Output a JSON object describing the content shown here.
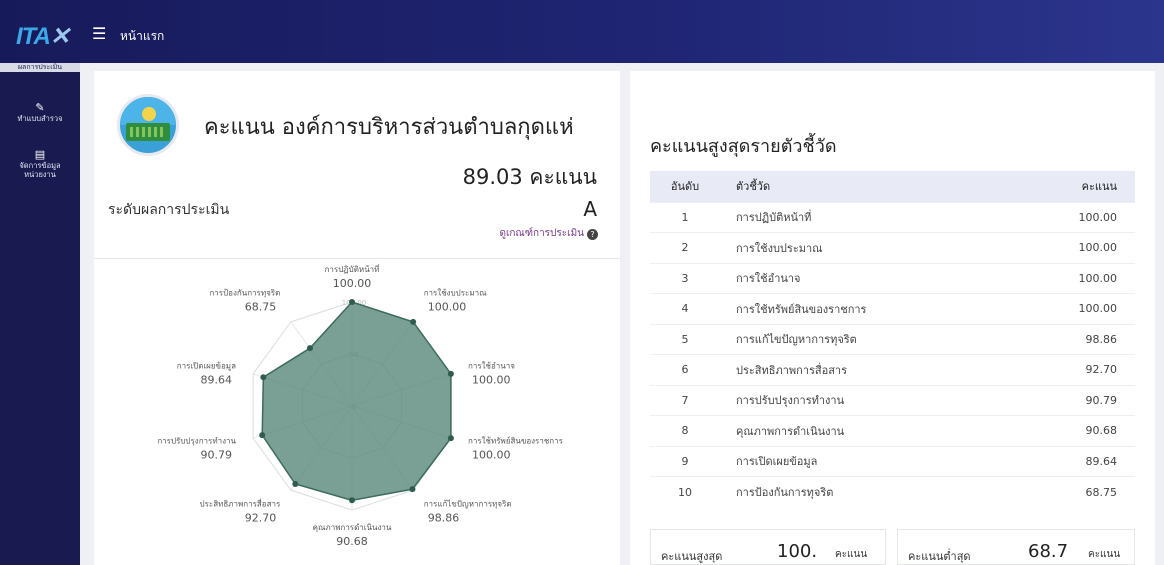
{
  "app": {
    "logo_text": "ITA",
    "logo_mark": "✕",
    "nav_home": "หน้าแรก"
  },
  "sidebar": {
    "cut_label": "ผลการประเมิน",
    "items": [
      {
        "icon": "edit-icon",
        "glyph": "✎",
        "label": "ทำแบบสำรวจ"
      },
      {
        "icon": "clipboard-icon",
        "glyph": "▤",
        "label_line1": "จัดการข้อมูล",
        "label_line2": "หน่วยงาน"
      }
    ]
  },
  "summary": {
    "org_title": "คะแนน องค์การบริหารส่วนตำบลกุดแห่",
    "total_score": "89.03 คะแนน",
    "level_label": "ระดับผลการประเมิน",
    "level_value": "A",
    "criteria_link": "ดูเกณฑ์การประเมิน"
  },
  "chart_data": {
    "type": "radar",
    "title": "",
    "rmax": 100,
    "ring_labels": [
      "0",
      "50",
      "100.00"
    ],
    "categories": [
      "การปฏิบัติหน้าที่",
      "การใช้งบประมาณ",
      "การใช้อำนาจ",
      "การใช้ทรัพย์สินของราชการ",
      "การแก้ไขปัญหาการทุจริต",
      "คุณภาพการดำเนินงาน",
      "ประสิทธิภาพการสื่อสาร",
      "การปรับปรุงการทำงาน",
      "การเปิดเผยข้อมูล",
      "การป้องกันการทุจริต"
    ],
    "values": [
      100.0,
      100.0,
      100.0,
      100.0,
      98.86,
      90.68,
      92.7,
      90.79,
      89.64,
      68.75
    ],
    "value_labels": [
      "100.00",
      "100.00",
      "100.00",
      "100.00",
      "98.86",
      "90.68",
      "92.70",
      "90.79",
      "89.64",
      "68.75"
    ],
    "fill_color": "#5d8a7c",
    "line_color": "#3c6b5d"
  },
  "ranking": {
    "title": "คะแนนสูงสุดรายตัวชี้วัด",
    "headers": {
      "rank": "อันดับ",
      "indicator": "ตัวชี้วัด",
      "score": "คะแนน"
    },
    "rows": [
      {
        "rank": "1",
        "name": "การปฏิบัติหน้าที่",
        "score": "100.00"
      },
      {
        "rank": "2",
        "name": "การใช้งบประมาณ",
        "score": "100.00"
      },
      {
        "rank": "3",
        "name": "การใช้อำนาจ",
        "score": "100.00"
      },
      {
        "rank": "4",
        "name": "การใช้ทรัพย์สินของราชการ",
        "score": "100.00"
      },
      {
        "rank": "5",
        "name": "การแก้ไขปัญหาการทุจริต",
        "score": "98.86"
      },
      {
        "rank": "6",
        "name": "ประสิทธิภาพการสื่อสาร",
        "score": "92.70"
      },
      {
        "rank": "7",
        "name": "การปรับปรุงการทำงาน",
        "score": "90.79"
      },
      {
        "rank": "8",
        "name": "คุณภาพการดำเนินงาน",
        "score": "90.68"
      },
      {
        "rank": "9",
        "name": "การเปิดเผยข้อมูล",
        "score": "89.64"
      },
      {
        "rank": "10",
        "name": "การป้องกันการทุจริต",
        "score": "68.75"
      }
    ]
  },
  "stats": {
    "max_label": "คะแนนสูงสุด",
    "max_value": "100.",
    "max_unit": "คะแนน",
    "min_label": "คะแนนต่ำสุด",
    "min_value": "68.7",
    "min_unit": "คะแนน"
  },
  "colors": {
    "nav": "#1f2573",
    "sidebar": "#191b50",
    "header_row": "#e8eaf6"
  }
}
